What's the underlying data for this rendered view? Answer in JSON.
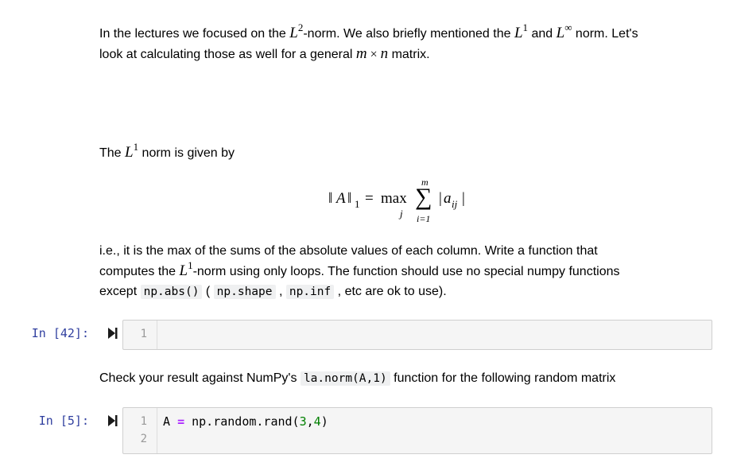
{
  "markdown": {
    "intro": {
      "line1_a": "In the lectures we focused on the ",
      "L": "L",
      "sup2": "2",
      "line1_b": "-norm. We also briefly mentioned the ",
      "sup1": "1",
      "and": " and ",
      "supinf": "∞",
      "line1_c": " norm. Let's",
      "line2_a": "look at calculating those as well for a general ",
      "m": "m",
      "times": " × ",
      "n": "n",
      "line2_b": " matrix."
    },
    "l1_intro": {
      "the": "The ",
      "L": "L",
      "sup1": "1",
      "rest": " norm is given by"
    },
    "equation": {
      "lhs_norm_open": "‖",
      "lhs_A": "A",
      "lhs_norm_close": "‖",
      "lhs_sub": "1",
      "equals": "=",
      "max": "max",
      "max_sub": "j",
      "sigma": "∑",
      "sigma_top": "m",
      "sigma_bottom": "i=1",
      "abs_open": "|",
      "term": "a",
      "term_sub": "ij",
      "abs_close": "|"
    },
    "instructions": {
      "line1": "i.e., it is the max of the sums of the absolute values of each column. Write a function that",
      "line2_a": "computes the ",
      "L": "L",
      "sup1": "1",
      "line2_b": "-norm using only loops. The function should use no special numpy functions",
      "line3_a": "except ",
      "code1": "np.abs()",
      "line3_b": " ( ",
      "code2": "np.shape",
      "line3_c": " , ",
      "code3": "np.inf",
      "line3_d": " , etc are ok to use)."
    },
    "check": {
      "text_a": "Check your result against NumPy's ",
      "code": "la.norm(A,1)",
      "text_b": " function for the following random matrix"
    }
  },
  "cells": [
    {
      "prompt": "In [42]:",
      "run_icon": "run-cell-icon",
      "lines": [
        {
          "no": "1",
          "code": ""
        }
      ]
    },
    {
      "prompt": "In [5]:",
      "run_icon": "run-cell-icon",
      "lines": [
        {
          "no": "1",
          "tokens": {
            "a": "A ",
            "op": "=",
            "b": " np.random.rand(",
            "n1": "3",
            "comma": ",",
            "n2": "4",
            "close": ")"
          }
        },
        {
          "no": "2",
          "code": ""
        }
      ]
    }
  ],
  "colors": {
    "prompt": "#303f9f",
    "cell_bg": "#f5f5f5",
    "cell_border": "#cfcfcf",
    "operator": "#aa22ff",
    "number": "#008000",
    "inline_code_bg": "#eff0f1"
  }
}
